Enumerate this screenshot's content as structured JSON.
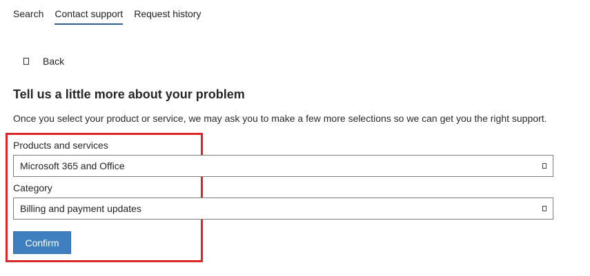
{
  "tabs": [
    {
      "label": "Search",
      "active": false
    },
    {
      "label": "Contact support",
      "active": true
    },
    {
      "label": "Request history",
      "active": false
    }
  ],
  "back": {
    "label": "Back",
    "icon": "back-icon"
  },
  "form": {
    "heading": "Tell us a little more about your problem",
    "description": "Once you select your product or service, we may ask you to make a few more selections so we can get you the right support.",
    "products": {
      "label": "Products and services",
      "value": "Microsoft 365 and Office"
    },
    "category": {
      "label": "Category",
      "value": "Billing and payment updates"
    },
    "confirm_label": "Confirm"
  },
  "colors": {
    "accent": "#3f7fbf",
    "tab_underline": "#2f5d8a",
    "highlight": "#d9262b"
  }
}
